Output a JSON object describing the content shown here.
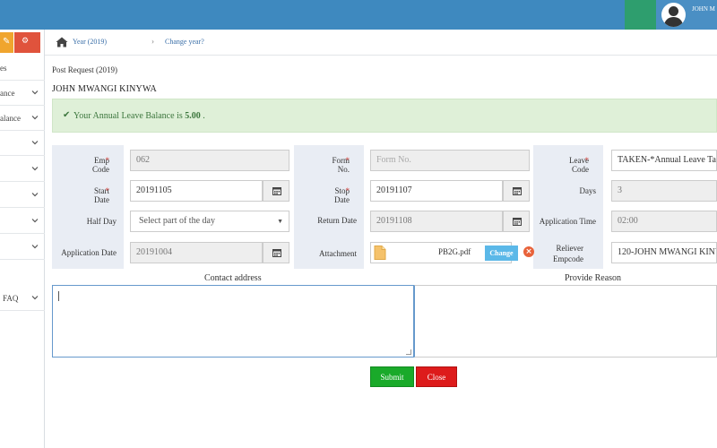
{
  "header": {
    "username": "JOHN M"
  },
  "sidebar": {
    "items": [
      {
        "label": "es"
      },
      {
        "label": "ance"
      },
      {
        "label": "alance"
      },
      {
        "label": ""
      },
      {
        "label": ""
      },
      {
        "label": ""
      },
      {
        "label": ""
      },
      {
        "label": ""
      },
      {
        "label": "FAQ"
      }
    ]
  },
  "breadcrumb": {
    "year": "Year (2019)",
    "separator": "›",
    "change": "Change year?"
  },
  "page": {
    "subtitle": "Post Request (2019)",
    "employee_name": "JOHN MWANGI KINYWA"
  },
  "alert": {
    "icon": "check-icon",
    "text": "Your Annual Leave Balance is ",
    "balance": "5.00",
    "suffix": " ."
  },
  "form": {
    "emp_code_label": "Emp Code",
    "emp_code": "062",
    "form_no_label": "Form No.",
    "form_no_placeholder": "Form No.",
    "leave_code_label": "Leave Code",
    "leave_code": "TAKEN-*Annual Leave Ta",
    "start_date_label": "Start Date",
    "start_date": "20191105",
    "stop_date_label": "Stop Date",
    "stop_date": "20191107",
    "days_label": "Days",
    "days": "3",
    "half_day_label": "Half Day",
    "half_day_value": "Select part of the day",
    "return_date_label": "Return Date",
    "return_date": "20191108",
    "application_time_label": "Application Time",
    "application_time": "02:00",
    "application_date_label": "Application Date",
    "application_date": "20191004",
    "attachment_label": "Attachment",
    "attachment_file": "PB2G.pdf",
    "change_label": "Change",
    "remove_label": "×",
    "reliever_label_1": "Reliever",
    "reliever_label_2": "Empcode",
    "reliever": "120-JOHN MWANGI KINY",
    "required_mark": "*"
  },
  "contact_address_label": "Contact address",
  "provide_reason_label": "Provide Reason",
  "buttons": {
    "submit": "Submit",
    "close": "Close"
  },
  "colors": {
    "topbar": "#3e89bf",
    "alert_bg": "#dff0d8",
    "alert_text": "#3c763d",
    "submit": "#1aaa2a",
    "close": "#dd1b1b",
    "change": "#5bb8e8"
  }
}
